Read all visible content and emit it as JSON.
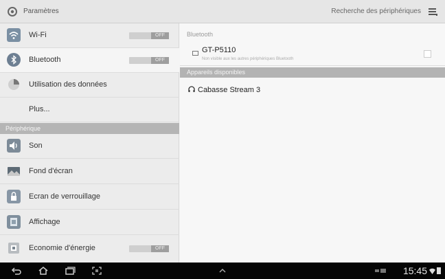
{
  "actionbar": {
    "title": "Paramètres",
    "search_label": "Recherche des périphériques"
  },
  "sidebar": {
    "wireless_items": [
      {
        "label": "Wi-Fi",
        "icon": "wifi-icon",
        "toggle": "OFF"
      },
      {
        "label": "Bluetooth",
        "icon": "bluetooth-icon",
        "toggle": "OFF"
      },
      {
        "label": "Utilisation des données",
        "icon": "data-usage-icon"
      },
      {
        "label": "Plus..."
      }
    ],
    "section_header": "Périphérique",
    "device_items": [
      {
        "label": "Son",
        "icon": "sound-icon"
      },
      {
        "label": "Fond d'écran",
        "icon": "wallpaper-icon"
      },
      {
        "label": "Ecran de verrouillage",
        "icon": "lock-screen-icon"
      },
      {
        "label": "Affichage",
        "icon": "display-icon"
      },
      {
        "label": "Economie d'énergie",
        "icon": "power-saving-icon",
        "toggle": "OFF"
      }
    ]
  },
  "bluetooth_panel": {
    "category": "Bluetooth",
    "my_device": {
      "name": "GT-P5110",
      "subtitle": "Non visible aux les autres périphériques Bluetooth"
    },
    "available_header": "Appareils disponibles",
    "available_devices": [
      {
        "name": "Cabasse Stream 3",
        "icon": "headphones-icon"
      }
    ]
  },
  "navbar": {
    "time": "15:45",
    "icons": [
      "back-icon",
      "home-icon",
      "recent-apps-icon",
      "screenshot-icon",
      "chevron-up-icon"
    ]
  }
}
